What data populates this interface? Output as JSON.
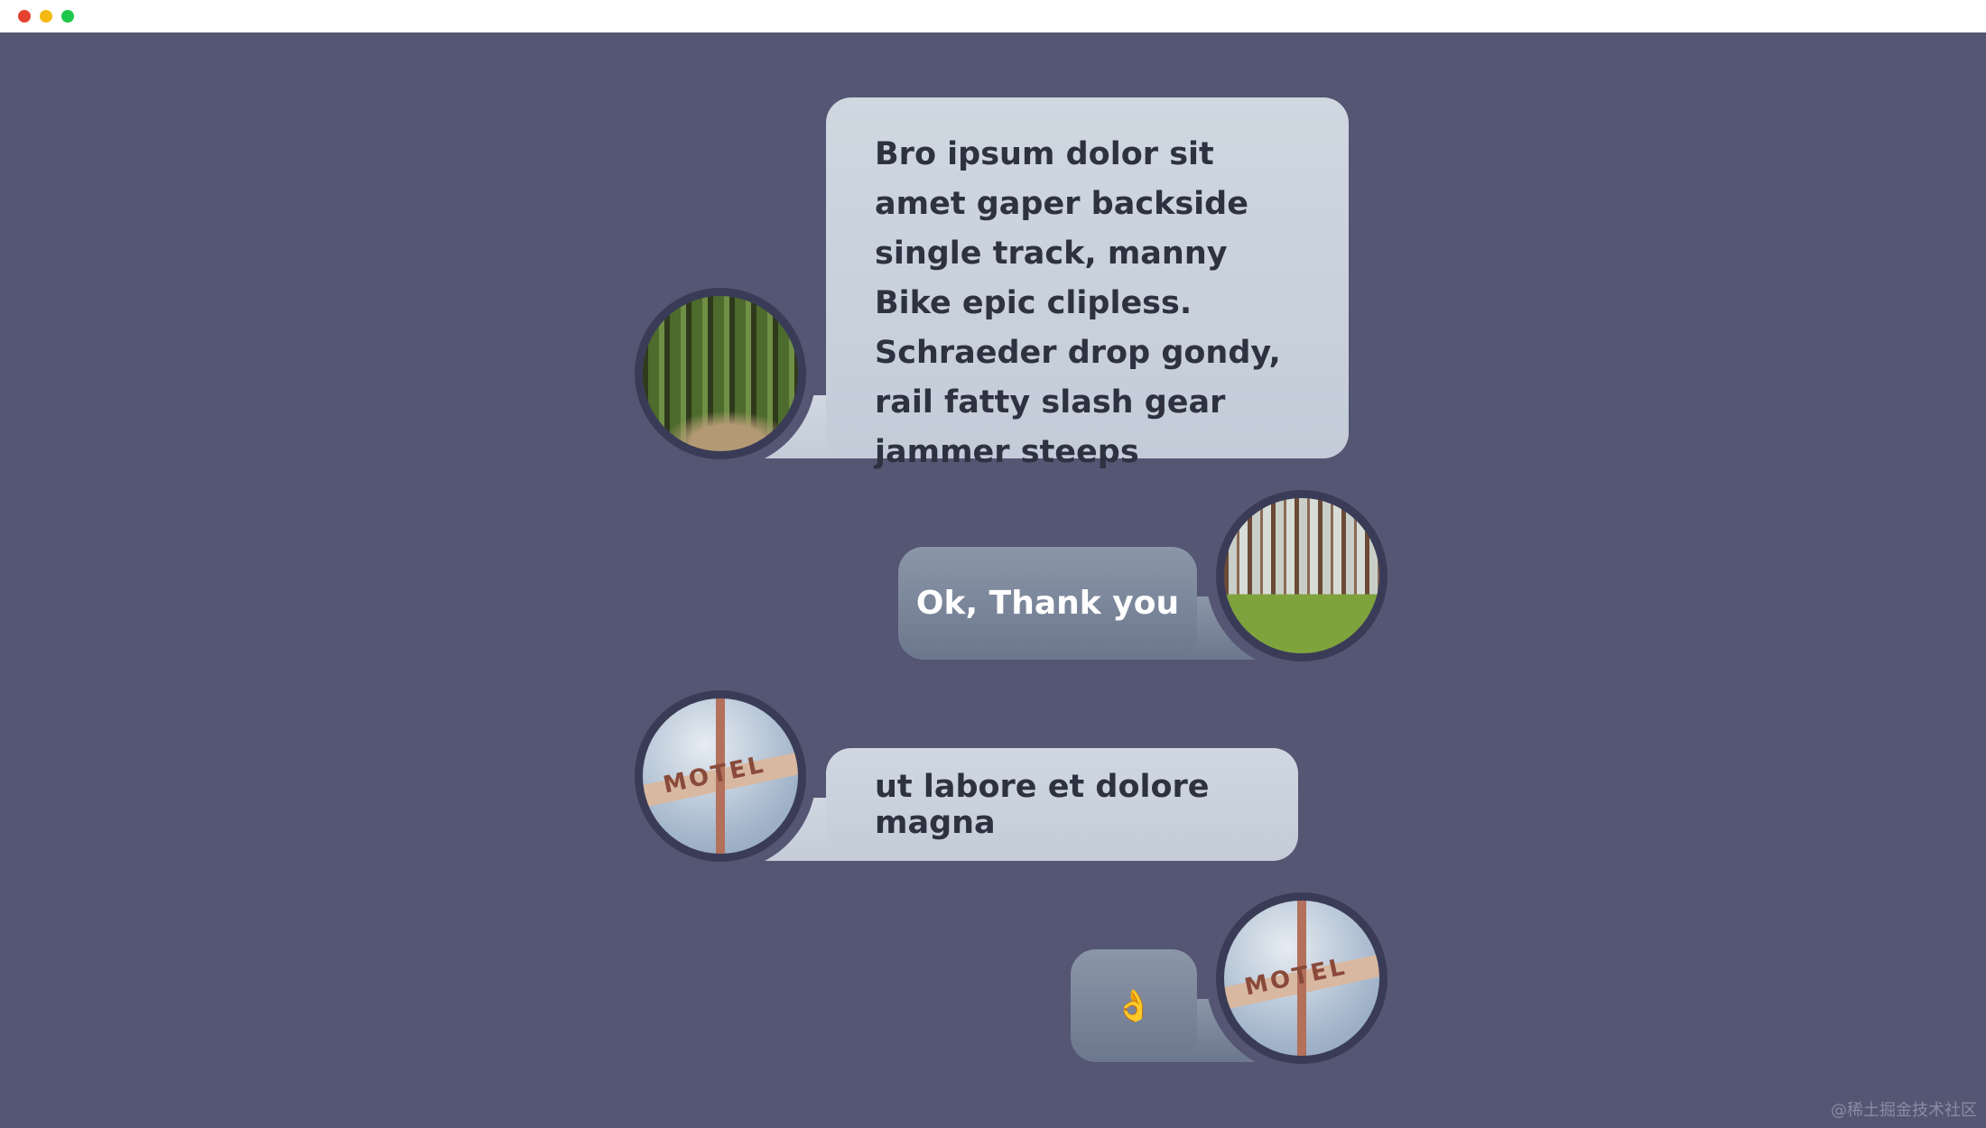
{
  "window": {
    "controls": [
      {
        "name": "close",
        "color": "#e5432f"
      },
      {
        "name": "minimize",
        "color": "#f5b914"
      },
      {
        "name": "maximize",
        "color": "#1ec74a"
      }
    ]
  },
  "colors": {
    "background": "#545673",
    "bubble_light": "#c9d2dd",
    "bubble_dark": "#7c879b",
    "ring": "#3a3c57"
  },
  "messages": [
    {
      "side": "left",
      "avatar": "forest-path-avatar",
      "text": "Bro ipsum dolor sit amet gaper backside single track, manny Bike epic clipless. Schraeder drop gondy, rail fatty slash gear jammer steeps"
    },
    {
      "side": "right",
      "avatar": "pine-forest-avatar",
      "text": "Ok, Thank you"
    },
    {
      "side": "left",
      "avatar": "motel-sign-avatar",
      "text": "ut labore et dolore magna",
      "avatar_sign": "MOTEL"
    },
    {
      "side": "right",
      "avatar": "motel-sign-avatar",
      "text": "👌",
      "avatar_sign": "MOTEL"
    }
  ],
  "watermark": "@稀土掘金技术社区"
}
